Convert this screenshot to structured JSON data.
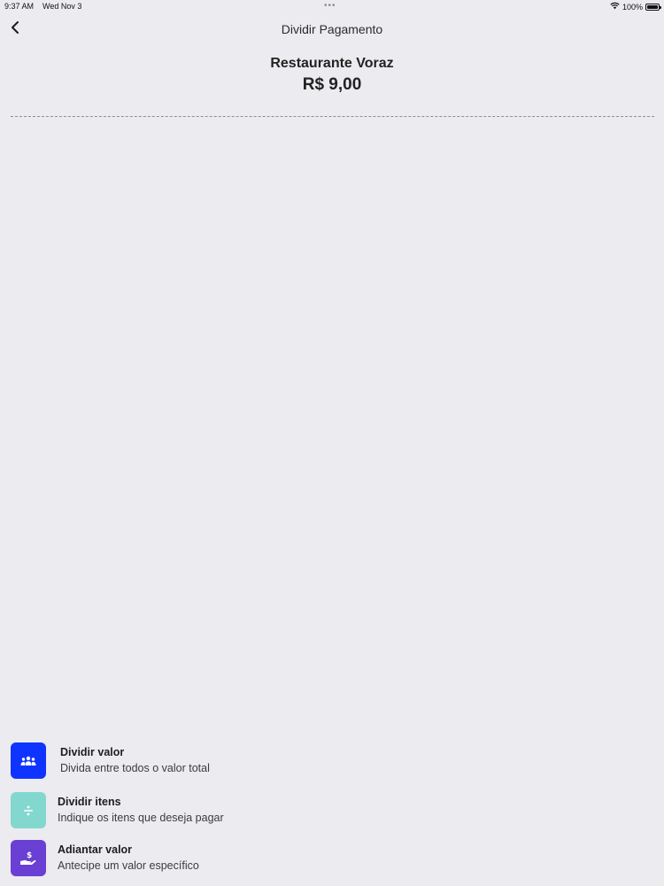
{
  "status_bar": {
    "time": "9:37 AM",
    "date": "Wed Nov 3",
    "multitask_dots": "•••",
    "battery_percent": "100%",
    "icons": [
      "wifi-icon",
      "battery-icon"
    ]
  },
  "nav": {
    "title": "Dividir Pagamento",
    "back_icon": "chevron-left-icon"
  },
  "header": {
    "restaurant": "Restaurante Voraz",
    "amount": "R$ 9,00"
  },
  "options": [
    {
      "title": "Dividir valor",
      "subtitle": "Divida entre todos o valor total",
      "icon": "group-icon",
      "color": "#1034ff"
    },
    {
      "title": "Dividir itens",
      "subtitle": "Indique os itens que deseja pagar",
      "icon": "divide-icon",
      "color": "#82d8cf"
    },
    {
      "title": "Adiantar valor",
      "subtitle": "Antecipe um valor específico",
      "icon": "hand-dollar-icon",
      "color": "#6a3fd3"
    }
  ]
}
